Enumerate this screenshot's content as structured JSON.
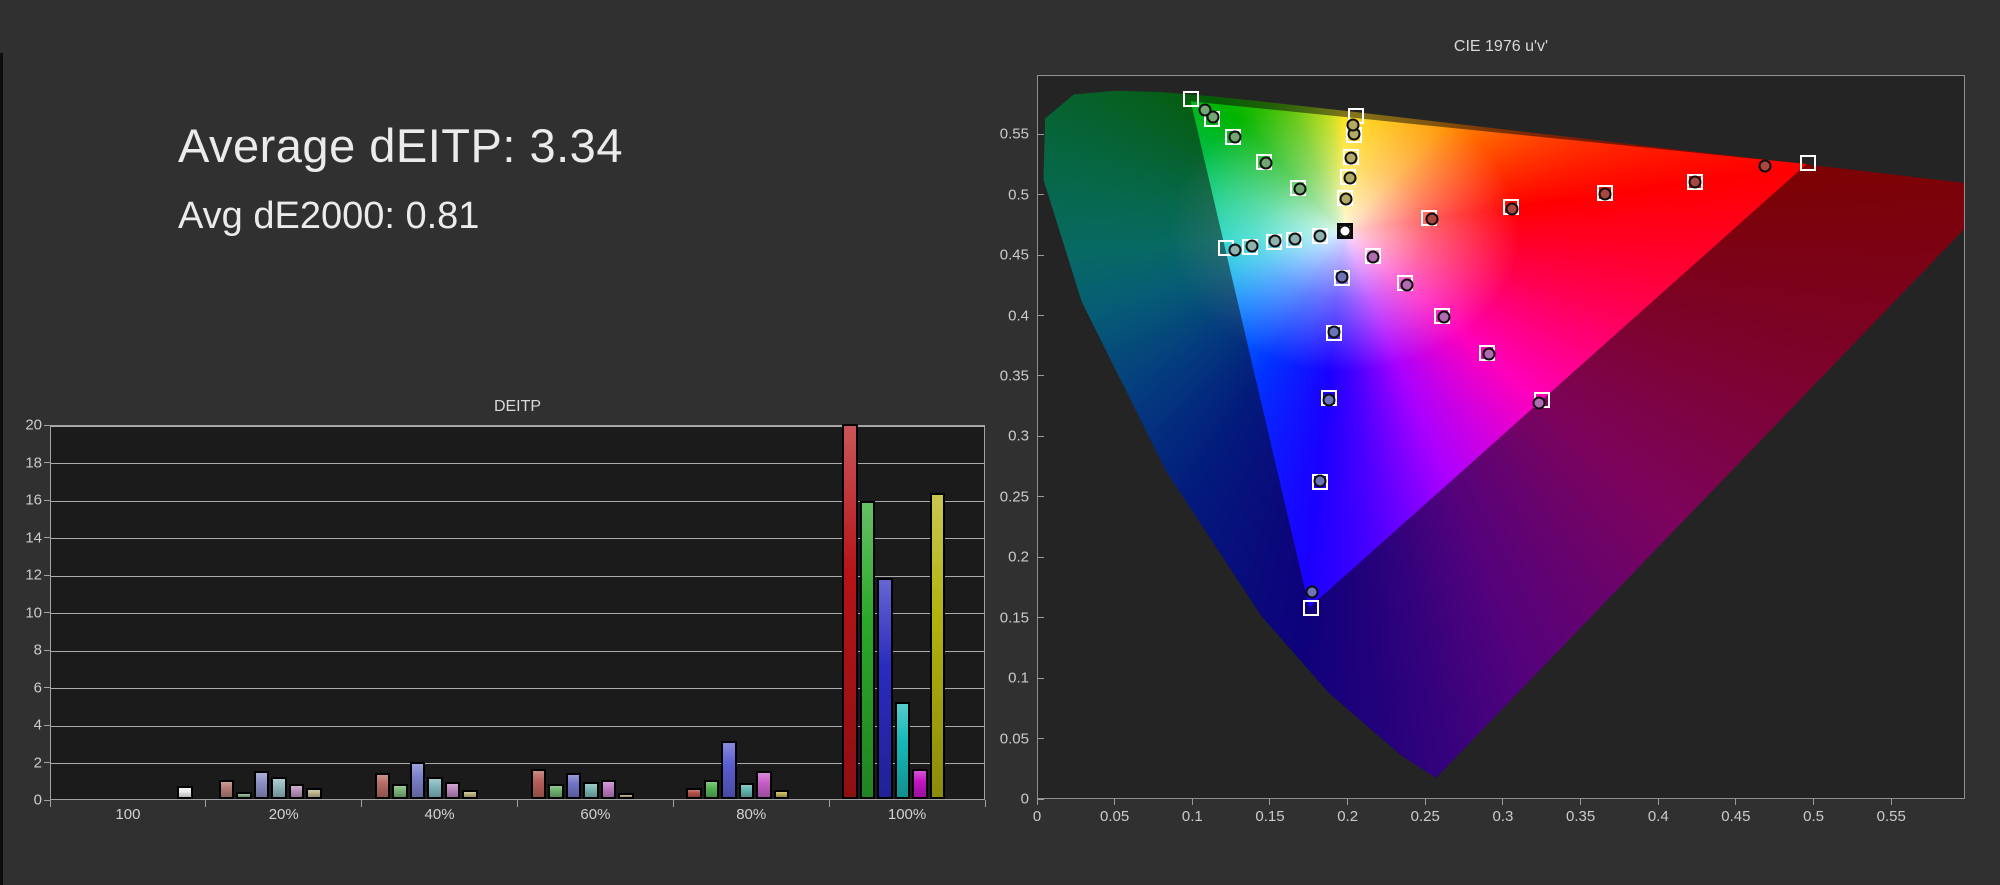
{
  "page": {
    "background": "#303030",
    "panel_bg": "#1b1b1b"
  },
  "summary": {
    "line1": "Average dEITP: 3.34",
    "line2": "Avg dE2000: 0.81",
    "avg_deitp": 3.34,
    "avg_de2000": 0.81
  },
  "chart_data": [
    {
      "type": "bar",
      "title": "DEITP",
      "xlabel": "",
      "ylabel": "",
      "ylim": [
        0,
        20
      ],
      "ytick_step": 2,
      "yticks": [
        0,
        2,
        4,
        6,
        8,
        10,
        12,
        14,
        16,
        18,
        20
      ],
      "grid": true,
      "note": "red bar in 100% group is clipped at top of axis (value >= 20)",
      "categories": [
        "100",
        "20%",
        "40%",
        "60%",
        "80%",
        "100%"
      ],
      "groups": [
        {
          "label": "100",
          "bars": [
            {
              "name": "white",
              "value": 0.7,
              "color": "#ededed"
            }
          ]
        },
        {
          "label": "20%",
          "bars": [
            {
              "name": "red",
              "value": 1.0,
              "color": "#b37b74"
            },
            {
              "name": "green",
              "value": 0.4,
              "color": "#86ae86"
            },
            {
              "name": "blue",
              "value": 1.5,
              "color": "#8a8fc4"
            },
            {
              "name": "cyan",
              "value": 1.2,
              "color": "#93b7bd"
            },
            {
              "name": "magenta",
              "value": 0.8,
              "color": "#b993bb"
            },
            {
              "name": "yellow",
              "value": 0.6,
              "color": "#bdb48b"
            }
          ]
        },
        {
          "label": "40%",
          "bars": [
            {
              "name": "red",
              "value": 1.4,
              "color": "#b56a64"
            },
            {
              "name": "green",
              "value": 0.8,
              "color": "#79b279"
            },
            {
              "name": "blue",
              "value": 2.0,
              "color": "#7b7fc9"
            },
            {
              "name": "cyan",
              "value": 1.2,
              "color": "#7fb5bd"
            },
            {
              "name": "magenta",
              "value": 0.9,
              "color": "#bb85bd"
            },
            {
              "name": "yellow",
              "value": 0.5,
              "color": "#bdb27f"
            }
          ]
        },
        {
          "label": "60%",
          "bars": [
            {
              "name": "red",
              "value": 1.6,
              "color": "#b55f58"
            },
            {
              "name": "green",
              "value": 0.8,
              "color": "#6cb26c"
            },
            {
              "name": "blue",
              "value": 1.4,
              "color": "#6f74c6"
            },
            {
              "name": "cyan",
              "value": 0.9,
              "color": "#79b5b2"
            },
            {
              "name": "magenta",
              "value": 1.0,
              "color": "#bd7bc2"
            },
            {
              "name": "yellow",
              "value": 0.3,
              "color": "#b5ac74"
            }
          ]
        },
        {
          "label": "80%",
          "bars": [
            {
              "name": "red",
              "value": 0.6,
              "color": "#b24f49"
            },
            {
              "name": "green",
              "value": 1.0,
              "color": "#54b254"
            },
            {
              "name": "blue",
              "value": 3.1,
              "color": "#5a5ecf"
            },
            {
              "name": "cyan",
              "value": 0.85,
              "color": "#63b5b0"
            },
            {
              "name": "magenta",
              "value": 1.5,
              "color": "#c75ec7"
            },
            {
              "name": "yellow",
              "value": 0.5,
              "color": "#bdb052"
            }
          ]
        },
        {
          "label": "100%",
          "bars": [
            {
              "name": "red",
              "value": 20,
              "clipped": true,
              "color": "#b51418"
            },
            {
              "name": "green",
              "value": 15.9,
              "color": "#2aa82a"
            },
            {
              "name": "blue",
              "value": 11.8,
              "color": "#2a2ac0"
            },
            {
              "name": "cyan",
              "value": 5.2,
              "color": "#16b8b8"
            },
            {
              "name": "magenta",
              "value": 1.6,
              "color": "#c414c4"
            },
            {
              "name": "yellow",
              "value": 16.3,
              "color": "#b2b20e"
            }
          ]
        }
      ]
    },
    {
      "type": "scatter",
      "title": "CIE 1976 u'v'",
      "xlim": [
        0,
        0.5975
      ],
      "ylim": [
        0,
        0.599
      ],
      "xticks": [
        "0",
        "0.05",
        "0.1",
        "0.15",
        "0.2",
        "0.25",
        "0.3",
        "0.35",
        "0.4",
        "0.45",
        "0.5",
        "0.55"
      ],
      "yticks": [
        "0",
        "0.05",
        "0.1",
        "0.15",
        "0.2",
        "0.25",
        "0.3",
        "0.35",
        "0.4",
        "0.45",
        "0.5",
        "0.55"
      ],
      "legend": "white squares = targets, dark circles = measurements, bright triangle = display gamut (P3), dimmed region = spectral locus outside gamut",
      "gamut_triangle": {
        "green": [
          0.0985,
          0.578
        ],
        "red": [
          0.496,
          0.526
        ],
        "blue": [
          0.175,
          0.158
        ]
      },
      "white_point": {
        "target": [
          0.198,
          0.47
        ],
        "measured": [
          0.198,
          0.47
        ]
      },
      "sweeps": [
        {
          "name": "red",
          "measured_fill": "#a8473f",
          "targets": [
            [
              0.252,
              0.481
            ],
            [
              0.305,
              0.49
            ],
            [
              0.366,
              0.502
            ],
            [
              0.424,
              0.511
            ],
            [
              0.497,
              0.527
            ]
          ],
          "measured": [
            [
              0.254,
              0.48
            ],
            [
              0.306,
              0.489
            ],
            [
              0.366,
              0.501
            ],
            [
              0.424,
              0.511
            ],
            [
              0.469,
              0.524
            ]
          ]
        },
        {
          "name": "green",
          "measured_fill": "#74a674",
          "targets": [
            [
              0.168,
              0.506
            ],
            [
              0.146,
              0.528
            ],
            [
              0.126,
              0.548
            ],
            [
              0.112,
              0.563
            ],
            [
              0.0985,
              0.58
            ]
          ],
          "measured": [
            [
              0.169,
              0.505
            ],
            [
              0.147,
              0.527
            ],
            [
              0.127,
              0.548
            ],
            [
              0.113,
              0.565
            ],
            [
              0.108,
              0.571
            ]
          ]
        },
        {
          "name": "blue",
          "measured_fill": "#6b74b8",
          "targets": [
            [
              0.196,
              0.431
            ],
            [
              0.191,
              0.386
            ],
            [
              0.188,
              0.332
            ],
            [
              0.182,
              0.262
            ],
            [
              0.176,
              0.158
            ]
          ],
          "measured": [
            [
              0.196,
              0.432
            ],
            [
              0.191,
              0.387
            ],
            [
              0.188,
              0.33
            ],
            [
              0.182,
              0.263
            ],
            [
              0.177,
              0.171
            ]
          ]
        },
        {
          "name": "cyan",
          "measured_fill": "#8fb2af",
          "targets": [
            [
              0.182,
              0.466
            ],
            [
              0.165,
              0.463
            ],
            [
              0.152,
              0.461
            ],
            [
              0.137,
              0.457
            ],
            [
              0.121,
              0.456
            ]
          ],
          "measured": [
            [
              0.182,
              0.466
            ],
            [
              0.166,
              0.464
            ],
            [
              0.153,
              0.462
            ],
            [
              0.138,
              0.458
            ],
            [
              0.127,
              0.455
            ]
          ]
        },
        {
          "name": "magenta",
          "measured_fill": "#b06cb0",
          "targets": [
            [
              0.216,
              0.45
            ],
            [
              0.237,
              0.427
            ],
            [
              0.261,
              0.4
            ],
            [
              0.29,
              0.369
            ],
            [
              0.325,
              0.33
            ]
          ],
          "measured": [
            [
              0.216,
              0.449
            ],
            [
              0.238,
              0.426
            ],
            [
              0.262,
              0.399
            ],
            [
              0.291,
              0.368
            ],
            [
              0.323,
              0.328
            ]
          ]
        },
        {
          "name": "yellow",
          "measured_fill": "#b3ab64",
          "targets": [
            [
              0.198,
              0.498
            ],
            [
              0.2,
              0.515
            ],
            [
              0.202,
              0.532
            ],
            [
              0.204,
              0.55
            ],
            [
              0.205,
              0.566
            ]
          ],
          "measured": [
            [
              0.199,
              0.497
            ],
            [
              0.201,
              0.514
            ],
            [
              0.202,
              0.531
            ],
            [
              0.204,
              0.551
            ],
            [
              0.203,
              0.558
            ]
          ]
        }
      ]
    }
  ]
}
